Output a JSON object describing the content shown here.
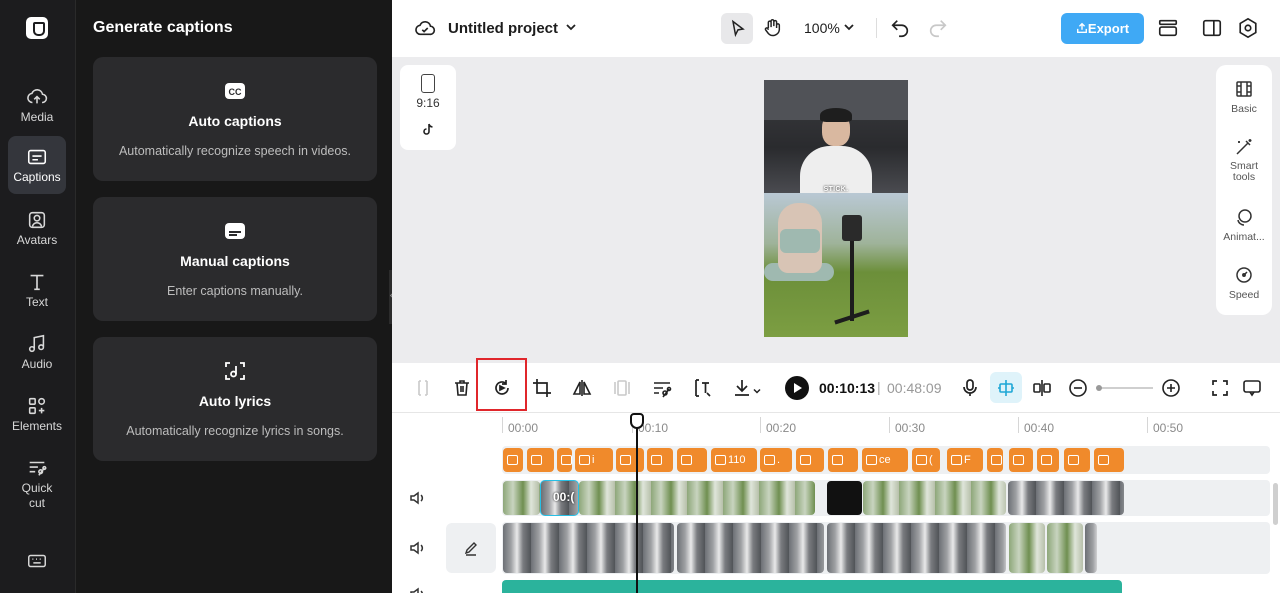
{
  "nav": {
    "items": [
      {
        "label": "Media",
        "icon": "cloud-upload-icon"
      },
      {
        "label": "Captions",
        "icon": "captions-icon",
        "active": true
      },
      {
        "label": "Avatars",
        "icon": "avatar-icon"
      },
      {
        "label": "Text",
        "icon": "text-icon"
      },
      {
        "label": "Audio",
        "icon": "music-note-icon"
      },
      {
        "label": "Elements",
        "icon": "elements-icon"
      },
      {
        "label": "Quick cut",
        "label_line1": "Quick",
        "label_line2": "cut",
        "icon": "quick-cut-icon"
      }
    ],
    "keyboard_icon": "keyboard-icon"
  },
  "panel": {
    "title": "Generate captions",
    "cards": [
      {
        "title": "Auto captions",
        "desc": "Automatically recognize speech in videos.",
        "icon": "cc-icon"
      },
      {
        "title": "Manual captions",
        "desc": "Enter captions manually.",
        "icon": "subtitle-icon"
      },
      {
        "title": "Auto lyrics",
        "desc": "Automatically recognize lyrics in songs.",
        "icon": "lyrics-icon"
      }
    ]
  },
  "topbar": {
    "project_title": "Untitled project",
    "zoom": "100%",
    "export_label": "Export"
  },
  "canvas": {
    "ratio_label": "9:16",
    "video_caption": "STICK."
  },
  "right_tools": [
    {
      "label": "Basic",
      "icon": "film-icon"
    },
    {
      "label": "Smart",
      "label2": "tools",
      "icon": "magic-wand-icon"
    },
    {
      "label": "Animat...",
      "icon": "animation-icon"
    },
    {
      "label": "Speed",
      "icon": "speed-icon"
    }
  ],
  "toolbar": {
    "current_time": "00:10:13",
    "separator": "|",
    "total_time": "00:48:09"
  },
  "timeline": {
    "ruler": [
      "00:00",
      "00:10",
      "00:20",
      "00:30",
      "00:40",
      "00:50"
    ],
    "caption_chips": [
      "",
      "",
      "(",
      "i",
      "",
      "",
      "",
      "110",
      ".",
      "",
      "",
      "ce",
      "(",
      "F",
      "(",
      "",
      "",
      "",
      ""
    ],
    "selected_clip_label": "00:(",
    "colors": {
      "caption_chip": "#f08a2b",
      "selection": "#27c0e6",
      "audio": "#2bb39c",
      "export": "#3fa9f5"
    }
  }
}
